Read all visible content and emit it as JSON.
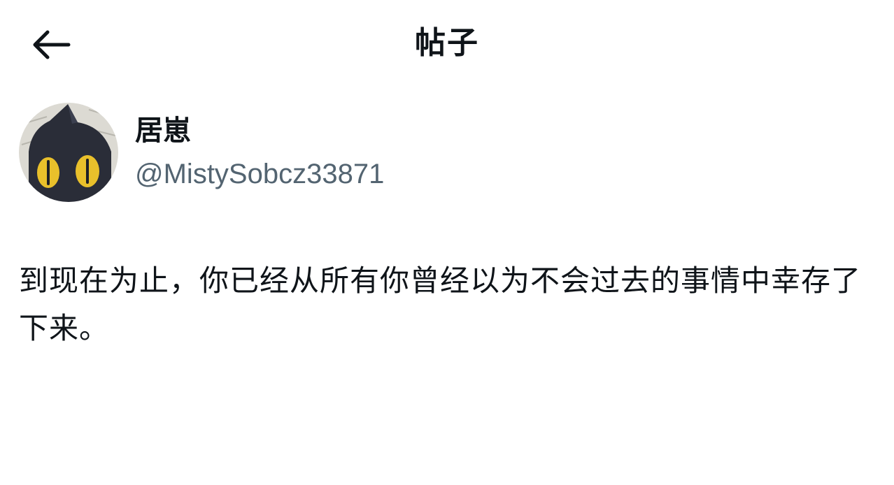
{
  "header": {
    "back_icon": "arrow-left-icon",
    "title": "帖子"
  },
  "author": {
    "avatar_icon": "black-cat-avatar",
    "display_name": "居崽",
    "handle": "@MistySobcz33871"
  },
  "post": {
    "text": "到现在为止，你已经从所有你曾经以为不会过去的事情中幸存了下来。"
  },
  "colors": {
    "text_primary": "#0f1419",
    "text_secondary": "#536471",
    "background": "#ffffff"
  }
}
